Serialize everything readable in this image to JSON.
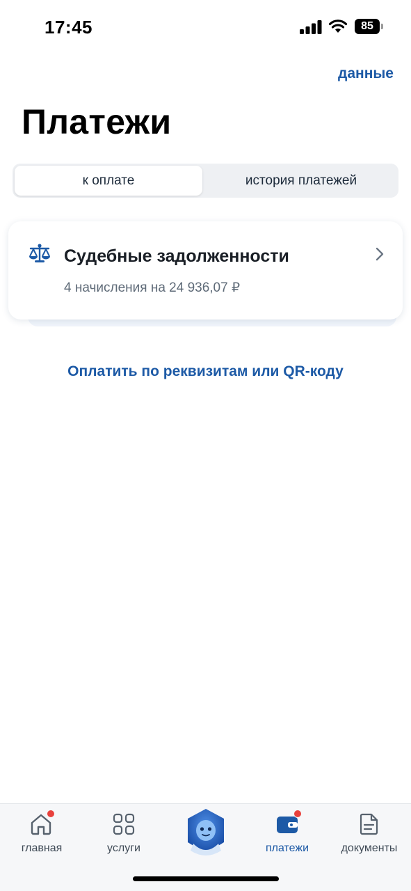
{
  "status_bar": {
    "time": "17:45",
    "battery": "85"
  },
  "header": {
    "data_link": "данные",
    "title": "Платежи"
  },
  "tabs": {
    "to_pay": "к оплате",
    "history": "история платежей",
    "active": "to_pay"
  },
  "debt_card": {
    "icon": "scales-icon",
    "title": "Судебные задолженности",
    "subtitle": "4 начисления на 24 936,07 ₽"
  },
  "qr_link": "Оплатить по реквизитам или QR-коду",
  "bottom_nav": {
    "home": "главная",
    "services": "услуги",
    "payments": "платежи",
    "documents": "документы",
    "active": "payments"
  },
  "colors": {
    "accent": "#1d5aa6",
    "badge": "#e8413c",
    "text_primary": "#1a1f26",
    "text_secondary": "#5f6b78"
  }
}
